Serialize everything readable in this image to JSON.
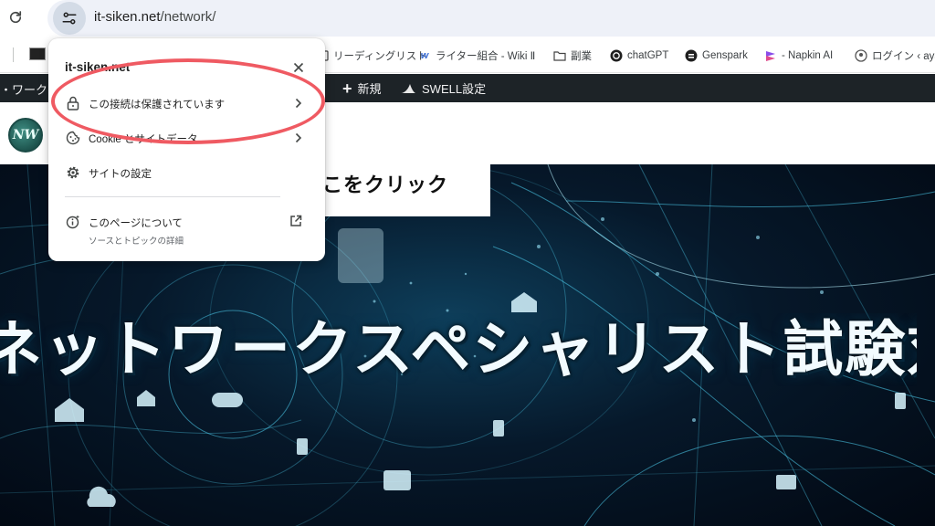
{
  "browser": {
    "url_host": "it-siken.net",
    "url_path": "/network/"
  },
  "bookmarks": [
    {
      "label": "リーディングリスト",
      "icon": "reading-list-icon"
    },
    {
      "label": "ライター組合 - Wiki Ⅱ",
      "icon": "wiki-logo-icon"
    },
    {
      "label": "副業",
      "icon": "folder-icon"
    },
    {
      "label": "chatGPT",
      "icon": "openai-logo-icon"
    },
    {
      "label": "Genspark",
      "icon": "genspark-logo-icon"
    },
    {
      "label": "- Napkin AI",
      "icon": "napkin-logo-icon"
    },
    {
      "label": "ログイン ‹ ayats",
      "icon": "wordpress-logo-icon"
    }
  ],
  "admin_bar": {
    "site_fragment": "ワークス",
    "new_label": "新規",
    "swell_label": "SWELL設定"
  },
  "site": {
    "logo_text": "NW"
  },
  "hero": {
    "title": "ネットワークスペシャリスト試験対策"
  },
  "callout": {
    "text": "ここをクリック"
  },
  "popup": {
    "title": "it-siken.net",
    "connection_label": "この接続は保護されています",
    "cookies_label": "Cookie とサイトデータ",
    "site_settings_label": "サイトの設定",
    "about_label": "このページについて",
    "about_sub": "ソースとトピックの詳細"
  },
  "colors": {
    "highlight": "#ef5a62",
    "admin_bar": "#1d2327",
    "omnibox": "#eef1f8"
  }
}
